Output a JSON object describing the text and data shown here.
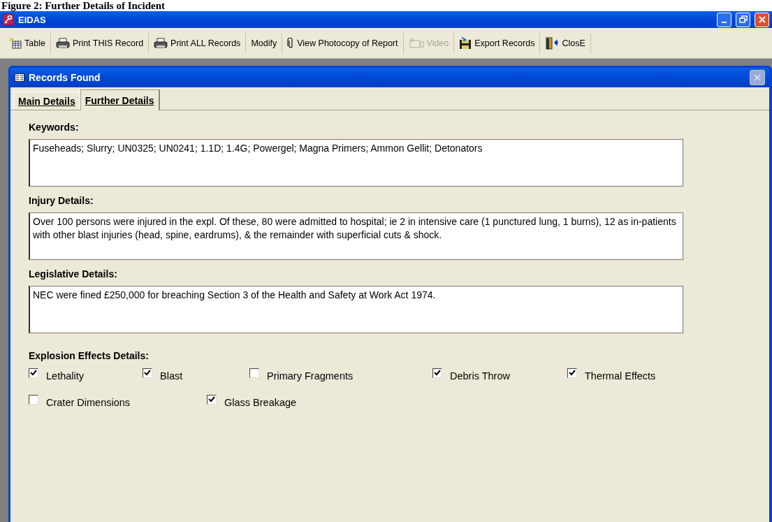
{
  "caption": "Figure 2: Further Details of Incident",
  "window": {
    "title": "EIDAS"
  },
  "toolbar": [
    {
      "label": "Table",
      "disabled": false
    },
    {
      "label": "Print THIS Record",
      "disabled": false
    },
    {
      "label": "Print ALL Records",
      "disabled": false
    },
    {
      "label": "Modify",
      "disabled": false
    },
    {
      "label": "View Photocopy of Report",
      "disabled": false
    },
    {
      "label": "Video",
      "disabled": true
    },
    {
      "label": "Export Records",
      "disabled": false
    },
    {
      "label": "ClosE",
      "disabled": false
    }
  ],
  "form": {
    "title": "Records Found",
    "tabs": [
      {
        "label": "Main Details",
        "selected": false
      },
      {
        "label": "Further Details",
        "selected": true
      }
    ],
    "fields": [
      {
        "label": "Keywords:",
        "value": "Fuseheads; Slurry; UN0325; UN0241; 1.1D; 1.4G; Powergel; Magna Primers; Ammon Gellit; Detonators"
      },
      {
        "label": "Injury Details:",
        "value": "Over 100 persons were injured in the expl. Of these, 80 were admitted to hospital; ie 2 in intensive care (1 punctured lung, 1 burns), 12 as in-patients with other blast injuries (head, spine, eardrums), & the remainder with superficial cuts & shock."
      },
      {
        "label": "Legislative Details:",
        "value": "NEC were fined £250,000 for breaching Section 3 of the Health and Safety at Work Act 1974."
      }
    ],
    "effects": {
      "label": "Explosion Effects Details:",
      "rows": [
        [
          {
            "label": "Lethality",
            "checked": true
          },
          {
            "label": "Blast",
            "checked": true
          },
          {
            "label": "Primary Fragments",
            "checked": false
          },
          {
            "label": "Debris Throw",
            "checked": true
          },
          {
            "label": "Thermal Effects",
            "checked": true
          }
        ],
        [
          {
            "label": "Crater Dimensions",
            "checked": false
          },
          {
            "label": "Glass Breakage",
            "checked": true
          }
        ]
      ]
    }
  }
}
